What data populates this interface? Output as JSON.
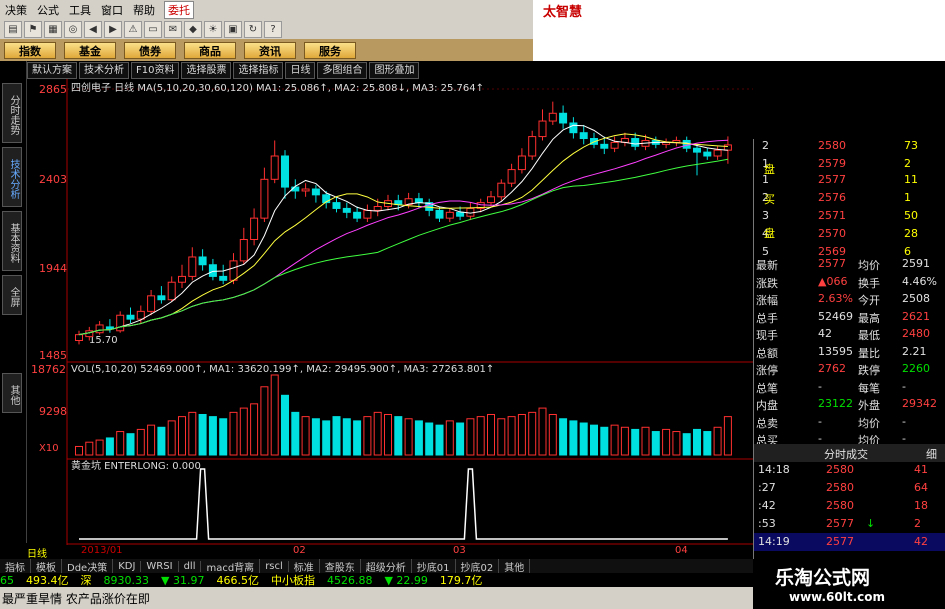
{
  "menubar": {
    "items": [
      "决策",
      "公式",
      "工具",
      "窗口",
      "帮助"
    ],
    "trade_tab": "委托",
    "brand": "太智慧"
  },
  "categories": [
    "指数",
    "基金",
    "债券",
    "商品",
    "资讯",
    "服务"
  ],
  "left_tabs": [
    "分时走势",
    "技术分析",
    "基本资料",
    "全屏",
    "其他"
  ],
  "chart_toolbar": [
    "默认方案",
    "技术分析",
    "F10资料",
    "选择股票",
    "选择指标",
    "日线",
    "多图组合",
    "图形叠加"
  ],
  "price_panel": {
    "header": "四创电子 日线 MA(5,10,20,30,60,120) MA1: 25.086↑, MA2: 25.808↓, MA3: 25.764↑",
    "y_labels": [
      "2865",
      "2403",
      "1944",
      "1485"
    ],
    "low_label": "15.70"
  },
  "vol_panel": {
    "header": "VOL(5,10,20) 52469.000↑, MA1: 33620.199↑, MA2: 29495.900↑, MA3: 27263.801↑",
    "y_labels": [
      "18762",
      "9298"
    ],
    "unit": "X10"
  },
  "ind_panel": {
    "header": "黄金坑 ENTERLONG: 0.000"
  },
  "bottom_axis": {
    "period": "日线",
    "dates": [
      "2013/01",
      "02",
      "03",
      "04"
    ]
  },
  "statusbar": [
    "指标",
    "模板",
    "Dde决策",
    "KDJ",
    "WRSI",
    "dll",
    "macd背离",
    "rscl",
    "标准",
    "查股东",
    "超级分析",
    "抄底01",
    "抄底02",
    "其他"
  ],
  "ticker": [
    {
      "text": "65",
      "color": "#00e000"
    },
    {
      "text": "493.4亿",
      "color": "#ffff00"
    },
    {
      "text": "深",
      "color": "#ffff00"
    },
    {
      "text": "8930.33",
      "color": "#00e000"
    },
    {
      "text": "▼ 31.97",
      "color": "#00e000"
    },
    {
      "text": "466.5亿",
      "color": "#ffff00"
    },
    {
      "text": "中小板指",
      "color": "#ffff00"
    },
    {
      "text": "4526.88",
      "color": "#00e000"
    },
    {
      "text": "▼ 22.99",
      "color": "#00e000"
    },
    {
      "text": "179.7亿",
      "color": "#ffff00"
    }
  ],
  "news": "最严重旱情 农产品涨价在即",
  "order_book": {
    "sell_label": "卖盘",
    "buy_label": "买盘",
    "sell": [
      {
        "lvl": "2",
        "price": "2580",
        "vol": "73"
      },
      {
        "lvl": "1",
        "price": "2579",
        "vol": "2"
      }
    ],
    "buy": [
      {
        "lvl": "1",
        "price": "2577",
        "vol": "11"
      },
      {
        "lvl": "2",
        "price": "2576",
        "vol": "1"
      },
      {
        "lvl": "3",
        "price": "2571",
        "vol": "50"
      },
      {
        "lvl": "4",
        "price": "2570",
        "vol": "28"
      },
      {
        "lvl": "5",
        "price": "2569",
        "vol": "6"
      }
    ]
  },
  "quote": [
    {
      "k1": "最新",
      "v1": "2577",
      "c1": "red",
      "k2": "均价",
      "v2": "2591",
      "c2": "white"
    },
    {
      "k1": "涨跌",
      "v1": "▲066",
      "c1": "red",
      "k2": "换手",
      "v2": "4.46%",
      "c2": "white"
    },
    {
      "k1": "涨幅",
      "v1": "2.63%",
      "c1": "red",
      "k2": "今开",
      "v2": "2508",
      "c2": "white"
    },
    {
      "k1": "总手",
      "v1": "52469",
      "c1": "white",
      "k2": "最高",
      "v2": "2621",
      "c2": "red"
    },
    {
      "k1": "现手",
      "v1": "42",
      "c1": "white",
      "k2": "最低",
      "v2": "2480",
      "c2": "red"
    },
    {
      "k1": "总额",
      "v1": "13595",
      "c1": "white",
      "k2": "量比",
      "v2": "2.21",
      "c2": "white"
    },
    {
      "k1": "涨停",
      "v1": "2762",
      "c1": "red",
      "k2": "跌停",
      "v2": "2260",
      "c2": "green"
    },
    {
      "k1": "总笔",
      "v1": "-",
      "c1": "white",
      "k2": "每笔",
      "v2": "-",
      "c2": "white"
    },
    {
      "k1": "内盘",
      "v1": "23122",
      "c1": "green",
      "k2": "外盘",
      "v2": "29342",
      "c2": "red"
    },
    {
      "k1": "总卖",
      "v1": "-",
      "c1": "white",
      "k2": "均价",
      "v2": "-",
      "c2": "white"
    },
    {
      "k1": "总买",
      "v1": "-",
      "c1": "white",
      "k2": "均价",
      "v2": "-",
      "c2": "white"
    }
  ],
  "ticks_header": "分时成交",
  "ticks_tab": "细",
  "ticks": [
    {
      "time": "14:18",
      "price": "2580",
      "vol": "41",
      "arrow": ""
    },
    {
      "time": ":27",
      "price": "2580",
      "vol": "64",
      "arrow": ""
    },
    {
      "time": ":42",
      "price": "2580",
      "vol": "18",
      "arrow": ""
    },
    {
      "time": ":53",
      "price": "2577",
      "vol": "2",
      "arrow": "↓"
    },
    {
      "time": "14:19",
      "price": "2577",
      "vol": "42",
      "arrow": ""
    }
  ],
  "watermark": {
    "title": "乐淘公式网",
    "url": "www.60lt.com"
  },
  "chart_data": {
    "type": "candlestick",
    "y_range": [
      1485,
      2865
    ],
    "candles": [
      [
        1570,
        1600,
        1550,
        1620
      ],
      [
        1590,
        1620,
        1570,
        1640
      ],
      [
        1610,
        1650,
        1600,
        1670
      ],
      [
        1640,
        1630,
        1610,
        1680
      ],
      [
        1620,
        1700,
        1610,
        1720
      ],
      [
        1700,
        1680,
        1660,
        1740
      ],
      [
        1680,
        1720,
        1660,
        1750
      ],
      [
        1720,
        1800,
        1700,
        1830
      ],
      [
        1800,
        1780,
        1760,
        1850
      ],
      [
        1780,
        1870,
        1770,
        1900
      ],
      [
        1870,
        1900,
        1840,
        1960
      ],
      [
        1900,
        2000,
        1880,
        2050
      ],
      [
        2000,
        1960,
        1930,
        2040
      ],
      [
        1960,
        1900,
        1880,
        1990
      ],
      [
        1900,
        1880,
        1860,
        1960
      ],
      [
        1880,
        1980,
        1860,
        2020
      ],
      [
        1980,
        2090,
        1960,
        2150
      ],
      [
        2090,
        2200,
        2060,
        2250
      ],
      [
        2200,
        2400,
        2180,
        2460
      ],
      [
        2400,
        2520,
        2380,
        2600
      ],
      [
        2520,
        2360,
        2300,
        2550
      ],
      [
        2360,
        2340,
        2300,
        2400
      ],
      [
        2340,
        2350,
        2310,
        2380
      ],
      [
        2350,
        2320,
        2280,
        2370
      ],
      [
        2320,
        2280,
        2250,
        2340
      ],
      [
        2280,
        2250,
        2230,
        2310
      ],
      [
        2250,
        2230,
        2200,
        2280
      ],
      [
        2230,
        2200,
        2180,
        2260
      ],
      [
        2200,
        2240,
        2180,
        2270
      ],
      [
        2240,
        2260,
        2210,
        2300
      ],
      [
        2260,
        2290,
        2240,
        2320
      ],
      [
        2290,
        2270,
        2240,
        2320
      ],
      [
        2270,
        2300,
        2250,
        2330
      ],
      [
        2300,
        2280,
        2250,
        2330
      ],
      [
        2280,
        2240,
        2210,
        2300
      ],
      [
        2240,
        2200,
        2180,
        2260
      ],
      [
        2200,
        2230,
        2180,
        2250
      ],
      [
        2230,
        2210,
        2190,
        2260
      ],
      [
        2210,
        2250,
        2190,
        2280
      ],
      [
        2250,
        2280,
        2230,
        2300
      ],
      [
        2280,
        2310,
        2260,
        2340
      ],
      [
        2310,
        2380,
        2290,
        2400
      ],
      [
        2380,
        2450,
        2360,
        2480
      ],
      [
        2450,
        2520,
        2430,
        2560
      ],
      [
        2520,
        2620,
        2500,
        2650
      ],
      [
        2620,
        2700,
        2600,
        2760
      ],
      [
        2700,
        2740,
        2680,
        2800
      ],
      [
        2740,
        2690,
        2660,
        2780
      ],
      [
        2690,
        2640,
        2610,
        2720
      ],
      [
        2640,
        2610,
        2580,
        2680
      ],
      [
        2610,
        2580,
        2560,
        2640
      ],
      [
        2580,
        2560,
        2530,
        2620
      ],
      [
        2560,
        2590,
        2540,
        2620
      ],
      [
        2590,
        2610,
        2570,
        2640
      ],
      [
        2610,
        2570,
        2550,
        2640
      ],
      [
        2570,
        2600,
        2550,
        2630
      ],
      [
        2600,
        2580,
        2560,
        2620
      ],
      [
        2580,
        2590,
        2560,
        2610
      ],
      [
        2590,
        2600,
        2570,
        2620
      ],
      [
        2600,
        2560,
        2540,
        2620
      ],
      [
        2560,
        2540,
        2420,
        2580
      ],
      [
        2540,
        2520,
        2500,
        2560
      ],
      [
        2520,
        2550,
        2500,
        2570
      ],
      [
        2550,
        2577,
        2480,
        2621
      ]
    ],
    "volume_range": [
      0,
      18762
    ],
    "volume": [
      2000,
      3000,
      3500,
      4000,
      5500,
      5000,
      6000,
      7000,
      6500,
      8000,
      9000,
      10000,
      9500,
      9000,
      8500,
      10000,
      11000,
      12000,
      16000,
      18762,
      14000,
      10000,
      9000,
      8500,
      8000,
      9000,
      8500,
      8000,
      9000,
      10000,
      9500,
      9000,
      8500,
      8000,
      7500,
      7000,
      8000,
      7500,
      8500,
      9000,
      9500,
      8500,
      9000,
      9500,
      10000,
      11000,
      9500,
      8500,
      8000,
      7500,
      7000,
      6500,
      7000,
      6500,
      6000,
      6500,
      5500,
      6000,
      5500,
      5000,
      6000,
      5500,
      6500,
      9000
    ],
    "indicator_peaks": [
      12,
      38
    ]
  }
}
